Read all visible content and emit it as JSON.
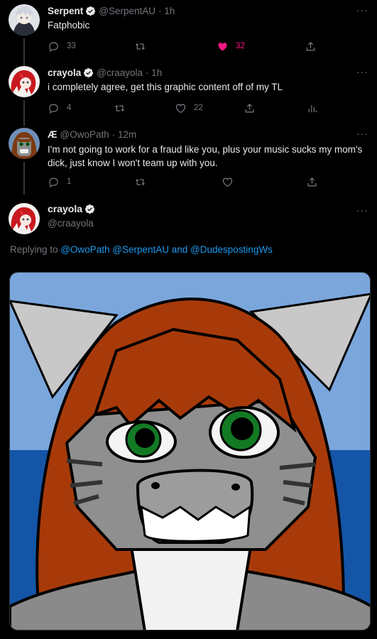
{
  "tweets": [
    {
      "name": "Serpent",
      "verified": true,
      "handle": "@SerpentAU",
      "time": "· 1h",
      "text": "Fatphobic",
      "actions": {
        "reply": "33",
        "retweet": "",
        "like": "32",
        "share": ""
      },
      "liked": true
    },
    {
      "name": "crayola",
      "verified": true,
      "handle": "@craayola",
      "time": "· 1h",
      "text": "i completely agree, get this graphic content off of my TL",
      "actions": {
        "reply": "4",
        "retweet": "",
        "like": "22",
        "share": ""
      }
    },
    {
      "name": "Æ",
      "verified": false,
      "handle": "@OwoPath",
      "time": "· 12m",
      "text_line1": "I'm not going to work for a fraud like you, plus your music sucks my mom's",
      "text_line2": "dick, just know I won't team up with you.",
      "actions": {
        "reply": "1",
        "retweet": "",
        "like": "",
        "share": ""
      }
    }
  ],
  "focus": {
    "name": "crayola",
    "handle": "@craayola",
    "replying_prefix": "Replying to",
    "replying_to": "@OwoPath @SerpentAU and @DudespostingWs"
  },
  "more_label": "···",
  "colors": {
    "background": "#000000",
    "text": "#e7e9ea",
    "muted": "#71767b",
    "link": "#1d9bf0",
    "like": "#f91880"
  },
  "icons": [
    "reply-icon",
    "retweet-icon",
    "like-icon",
    "share-icon",
    "analytics-icon",
    "verified-icon",
    "more-icon"
  ]
}
